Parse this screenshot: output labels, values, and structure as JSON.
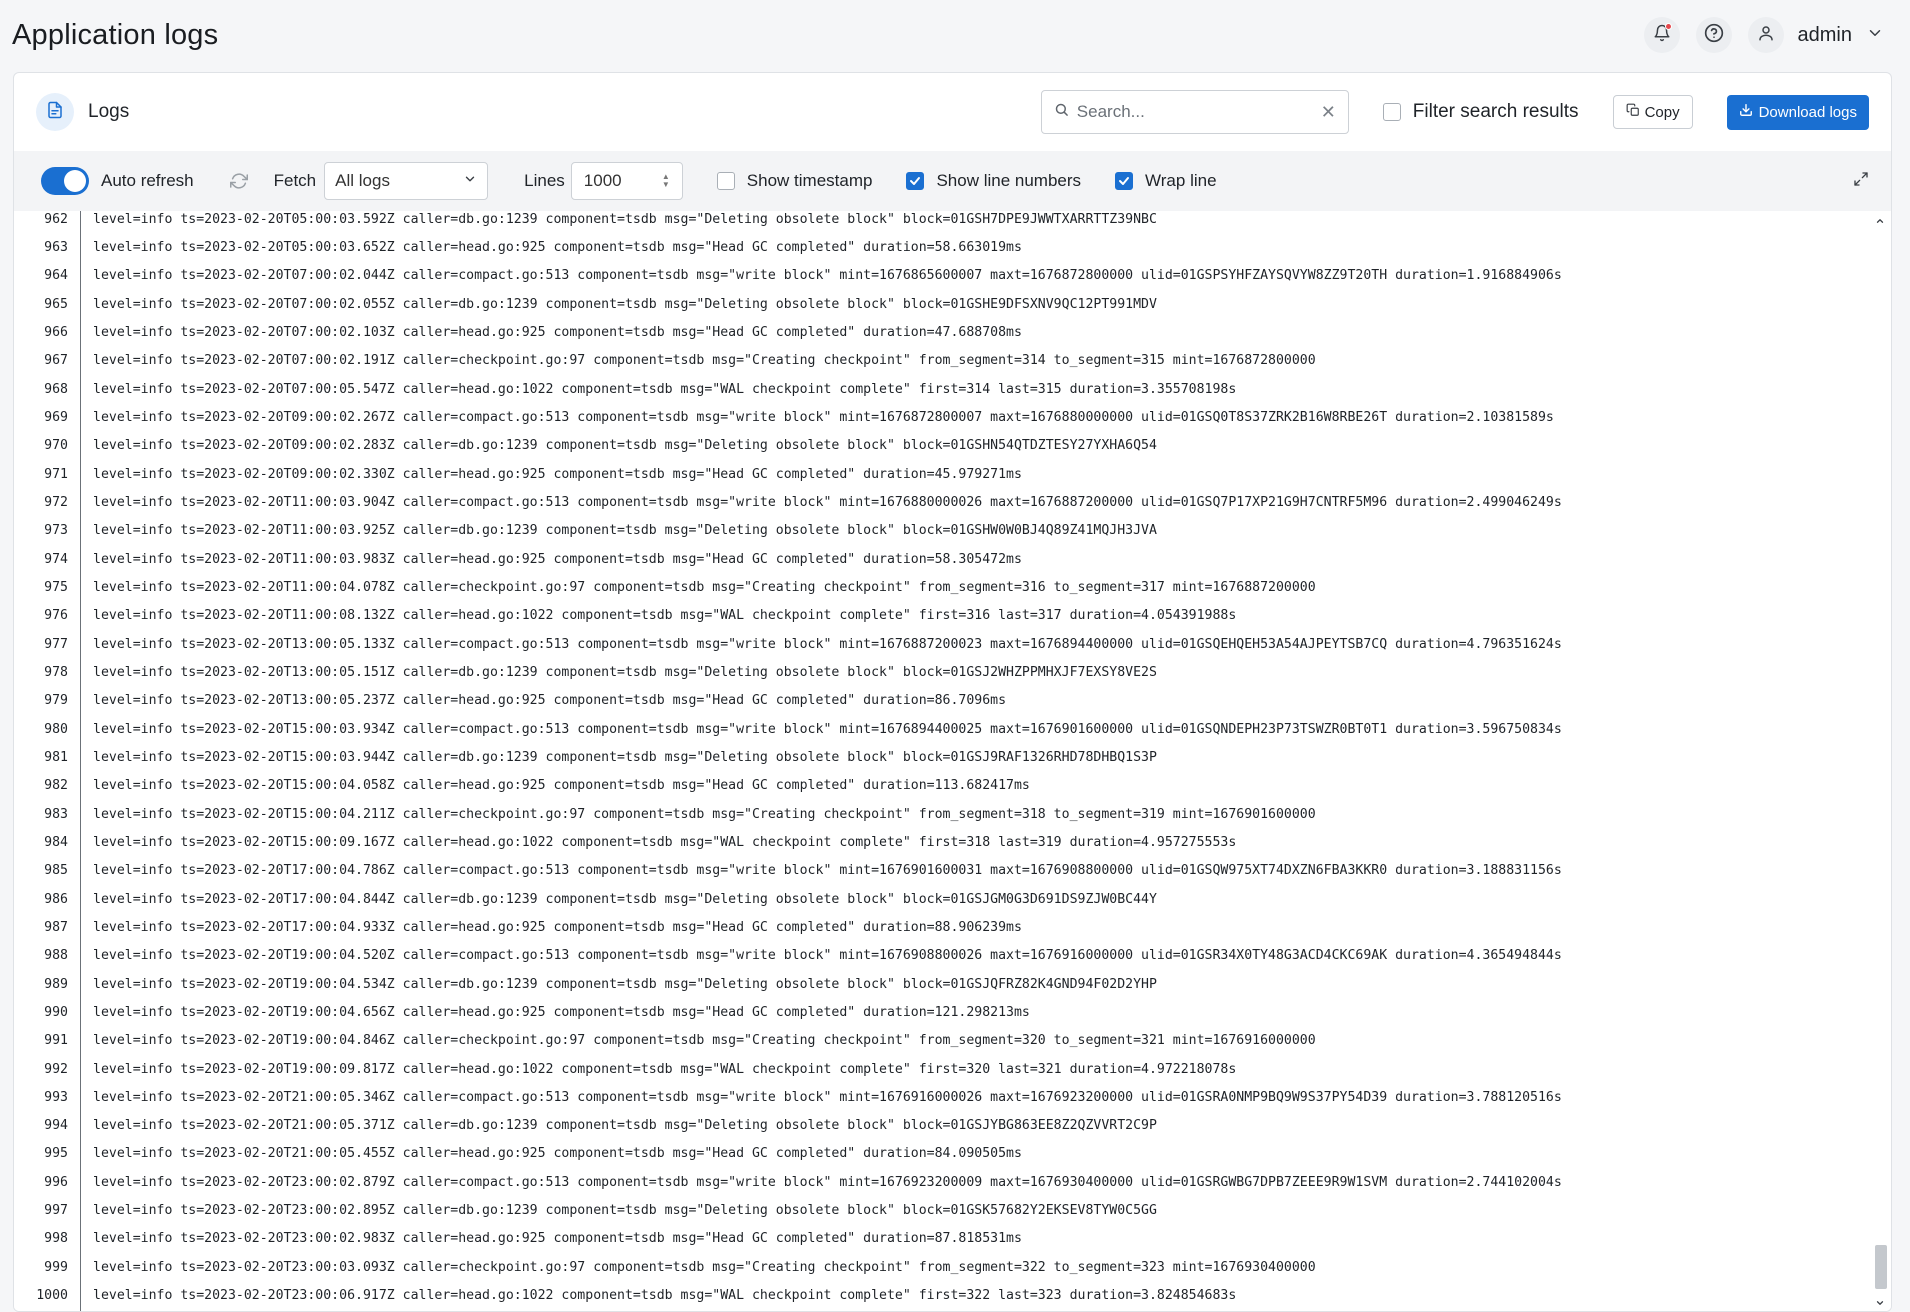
{
  "header": {
    "title": "Application logs",
    "user_name": "admin",
    "icons": [
      "bell-icon",
      "help-icon",
      "user-icon",
      "chevron-down-icon"
    ]
  },
  "panel": {
    "title": "Logs",
    "search_placeholder": "Search...",
    "search_value": "",
    "filter_label": "Filter search results",
    "filter_checked": false,
    "copy_label": "Copy",
    "download_label": "Download logs"
  },
  "toolbar": {
    "auto_refresh_label": "Auto refresh",
    "auto_refresh_on": true,
    "fetch_label": "Fetch",
    "fetch_value": "All logs",
    "lines_label": "Lines",
    "lines_value": "1000",
    "show_timestamp_label": "Show timestamp",
    "show_timestamp_checked": false,
    "show_line_numbers_label": "Show line numbers",
    "show_line_numbers_checked": true,
    "wrap_line_label": "Wrap line",
    "wrap_line_checked": true
  },
  "colors": {
    "accent": "#1a6fd1",
    "notification": "#e5484d"
  },
  "logs": [
    {
      "n": "962",
      "text": "level=info ts=2023-02-20T05:00:03.592Z caller=db.go:1239 component=tsdb msg=\"Deleting obsolete block\" block=01GSH7DPE9JWWTXARRTTZ39NBC"
    },
    {
      "n": "963",
      "text": "level=info ts=2023-02-20T05:00:03.652Z caller=head.go:925 component=tsdb msg=\"Head GC completed\" duration=58.663019ms"
    },
    {
      "n": "964",
      "text": "level=info ts=2023-02-20T07:00:02.044Z caller=compact.go:513 component=tsdb msg=\"write block\" mint=1676865600007 maxt=1676872800000 ulid=01GSPSYHFZAYSQVYW8ZZ9T20TH duration=1.916884906s"
    },
    {
      "n": "965",
      "text": "level=info ts=2023-02-20T07:00:02.055Z caller=db.go:1239 component=tsdb msg=\"Deleting obsolete block\" block=01GSHE9DFSXNV9QC12PT991MDV"
    },
    {
      "n": "966",
      "text": "level=info ts=2023-02-20T07:00:02.103Z caller=head.go:925 component=tsdb msg=\"Head GC completed\" duration=47.688708ms"
    },
    {
      "n": "967",
      "text": "level=info ts=2023-02-20T07:00:02.191Z caller=checkpoint.go:97 component=tsdb msg=\"Creating checkpoint\" from_segment=314 to_segment=315 mint=1676872800000"
    },
    {
      "n": "968",
      "text": "level=info ts=2023-02-20T07:00:05.547Z caller=head.go:1022 component=tsdb msg=\"WAL checkpoint complete\" first=314 last=315 duration=3.355708198s"
    },
    {
      "n": "969",
      "text": "level=info ts=2023-02-20T09:00:02.267Z caller=compact.go:513 component=tsdb msg=\"write block\" mint=1676872800007 maxt=1676880000000 ulid=01GSQ0T8S37ZRK2B16W8RBE26T duration=2.10381589s"
    },
    {
      "n": "970",
      "text": "level=info ts=2023-02-20T09:00:02.283Z caller=db.go:1239 component=tsdb msg=\"Deleting obsolete block\" block=01GSHN54QTDZTESY27YXHA6Q54"
    },
    {
      "n": "971",
      "text": "level=info ts=2023-02-20T09:00:02.330Z caller=head.go:925 component=tsdb msg=\"Head GC completed\" duration=45.979271ms"
    },
    {
      "n": "972",
      "text": "level=info ts=2023-02-20T11:00:03.904Z caller=compact.go:513 component=tsdb msg=\"write block\" mint=1676880000026 maxt=1676887200000 ulid=01GSQ7P17XP21G9H7CNTRF5M96 duration=2.499046249s"
    },
    {
      "n": "973",
      "text": "level=info ts=2023-02-20T11:00:03.925Z caller=db.go:1239 component=tsdb msg=\"Deleting obsolete block\" block=01GSHW0W0BJ4Q89Z41MQJH3JVA"
    },
    {
      "n": "974",
      "text": "level=info ts=2023-02-20T11:00:03.983Z caller=head.go:925 component=tsdb msg=\"Head GC completed\" duration=58.305472ms"
    },
    {
      "n": "975",
      "text": "level=info ts=2023-02-20T11:00:04.078Z caller=checkpoint.go:97 component=tsdb msg=\"Creating checkpoint\" from_segment=316 to_segment=317 mint=1676887200000"
    },
    {
      "n": "976",
      "text": "level=info ts=2023-02-20T11:00:08.132Z caller=head.go:1022 component=tsdb msg=\"WAL checkpoint complete\" first=316 last=317 duration=4.054391988s"
    },
    {
      "n": "977",
      "text": "level=info ts=2023-02-20T13:00:05.133Z caller=compact.go:513 component=tsdb msg=\"write block\" mint=1676887200023 maxt=1676894400000 ulid=01GSQEHQEH53A54AJPEYTSB7CQ duration=4.796351624s"
    },
    {
      "n": "978",
      "text": "level=info ts=2023-02-20T13:00:05.151Z caller=db.go:1239 component=tsdb msg=\"Deleting obsolete block\" block=01GSJ2WHZPPMHXJF7EXSY8VE2S"
    },
    {
      "n": "979",
      "text": "level=info ts=2023-02-20T13:00:05.237Z caller=head.go:925 component=tsdb msg=\"Head GC completed\" duration=86.7096ms"
    },
    {
      "n": "980",
      "text": "level=info ts=2023-02-20T15:00:03.934Z caller=compact.go:513 component=tsdb msg=\"write block\" mint=1676894400025 maxt=1676901600000 ulid=01GSQNDEPH23P73TSWZR0BT0T1 duration=3.596750834s"
    },
    {
      "n": "981",
      "text": "level=info ts=2023-02-20T15:00:03.944Z caller=db.go:1239 component=tsdb msg=\"Deleting obsolete block\" block=01GSJ9RAF1326RHD78DHBQ1S3P"
    },
    {
      "n": "982",
      "text": "level=info ts=2023-02-20T15:00:04.058Z caller=head.go:925 component=tsdb msg=\"Head GC completed\" duration=113.682417ms"
    },
    {
      "n": "983",
      "text": "level=info ts=2023-02-20T15:00:04.211Z caller=checkpoint.go:97 component=tsdb msg=\"Creating checkpoint\" from_segment=318 to_segment=319 mint=1676901600000"
    },
    {
      "n": "984",
      "text": "level=info ts=2023-02-20T15:00:09.167Z caller=head.go:1022 component=tsdb msg=\"WAL checkpoint complete\" first=318 last=319 duration=4.957275553s"
    },
    {
      "n": "985",
      "text": "level=info ts=2023-02-20T17:00:04.786Z caller=compact.go:513 component=tsdb msg=\"write block\" mint=1676901600031 maxt=1676908800000 ulid=01GSQW975XT74DXZN6FBA3KKR0 duration=3.188831156s"
    },
    {
      "n": "986",
      "text": "level=info ts=2023-02-20T17:00:04.844Z caller=db.go:1239 component=tsdb msg=\"Deleting obsolete block\" block=01GSJGM0G3D691DS9ZJW0BC44Y"
    },
    {
      "n": "987",
      "text": "level=info ts=2023-02-20T17:00:04.933Z caller=head.go:925 component=tsdb msg=\"Head GC completed\" duration=88.906239ms"
    },
    {
      "n": "988",
      "text": "level=info ts=2023-02-20T19:00:04.520Z caller=compact.go:513 component=tsdb msg=\"write block\" mint=1676908800026 maxt=1676916000000 ulid=01GSR34X0TY48G3ACD4CKC69AK duration=4.365494844s"
    },
    {
      "n": "989",
      "text": "level=info ts=2023-02-20T19:00:04.534Z caller=db.go:1239 component=tsdb msg=\"Deleting obsolete block\" block=01GSJQFRZ82K4GND94F02D2YHP"
    },
    {
      "n": "990",
      "text": "level=info ts=2023-02-20T19:00:04.656Z caller=head.go:925 component=tsdb msg=\"Head GC completed\" duration=121.298213ms"
    },
    {
      "n": "991",
      "text": "level=info ts=2023-02-20T19:00:04.846Z caller=checkpoint.go:97 component=tsdb msg=\"Creating checkpoint\" from_segment=320 to_segment=321 mint=1676916000000"
    },
    {
      "n": "992",
      "text": "level=info ts=2023-02-20T19:00:09.817Z caller=head.go:1022 component=tsdb msg=\"WAL checkpoint complete\" first=320 last=321 duration=4.972218078s"
    },
    {
      "n": "993",
      "text": "level=info ts=2023-02-20T21:00:05.346Z caller=compact.go:513 component=tsdb msg=\"write block\" mint=1676916000026 maxt=1676923200000 ulid=01GSRA0NMP9BQ9W9S37PY54D39 duration=3.788120516s"
    },
    {
      "n": "994",
      "text": "level=info ts=2023-02-20T21:00:05.371Z caller=db.go:1239 component=tsdb msg=\"Deleting obsolete block\" block=01GSJYBG863EE8Z2QZVVRT2C9P"
    },
    {
      "n": "995",
      "text": "level=info ts=2023-02-20T21:00:05.455Z caller=head.go:925 component=tsdb msg=\"Head GC completed\" duration=84.090505ms"
    },
    {
      "n": "996",
      "text": "level=info ts=2023-02-20T23:00:02.879Z caller=compact.go:513 component=tsdb msg=\"write block\" mint=1676923200009 maxt=1676930400000 ulid=01GSRGWBG7DPB7ZEEE9R9W1SVM duration=2.744102004s"
    },
    {
      "n": "997",
      "text": "level=info ts=2023-02-20T23:00:02.895Z caller=db.go:1239 component=tsdb msg=\"Deleting obsolete block\" block=01GSK57682Y2EKSEV8TYW0C5GG"
    },
    {
      "n": "998",
      "text": "level=info ts=2023-02-20T23:00:02.983Z caller=head.go:925 component=tsdb msg=\"Head GC completed\" duration=87.818531ms"
    },
    {
      "n": "999",
      "text": "level=info ts=2023-02-20T23:00:03.093Z caller=checkpoint.go:97 component=tsdb msg=\"Creating checkpoint\" from_segment=322 to_segment=323 mint=1676930400000"
    },
    {
      "n": "1000",
      "text": "level=info ts=2023-02-20T23:00:06.917Z caller=head.go:1022 component=tsdb msg=\"WAL checkpoint complete\" first=322 last=323 duration=3.824854683s"
    }
  ]
}
